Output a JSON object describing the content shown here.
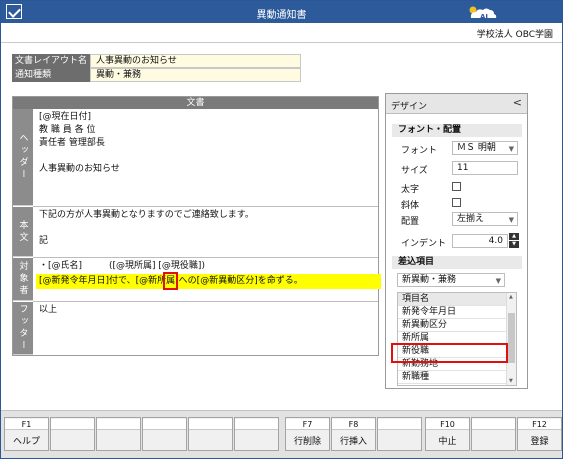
{
  "window": {
    "title": "異動通知書"
  },
  "header": {
    "org_name": "学校法人 OBC学園"
  },
  "form": {
    "layout_label": "文書レイアウト名",
    "layout_value": "人事異動のお知らせ",
    "type_label": "通知種類",
    "type_value": "異動・兼務"
  },
  "document": {
    "title": "文書",
    "sections": [
      {
        "label": "ヘッダー",
        "lines": [
          "[@現在日付]",
          "教 職 員 各 位",
          "責任者 管理部長",
          "",
          "人事異動のお知らせ"
        ]
      },
      {
        "label": "本文",
        "lines": [
          "下記の方が人事異動となりますのでご連絡致します。",
          "",
          "記"
        ]
      },
      {
        "label": "対象者",
        "lines": [
          "・[@氏名]　　　([@現所属] [@現役職])",
          "[@新発令年月日]付で、[@新所属]への[@新異動区分]を命ずる。"
        ]
      },
      {
        "label": "フッター",
        "lines": [
          "以上"
        ]
      }
    ]
  },
  "design": {
    "title": "デザイン",
    "collapse_glyph": "<",
    "font_group": "フォント・配置",
    "font_label": "フォント",
    "font_value": "ＭＳ 明朝",
    "size_label": "サイズ",
    "size_value": "11",
    "bold_label": "太字",
    "italic_label": "斜体",
    "align_label": "配置",
    "align_value": "左揃え",
    "indent_label": "インデント",
    "indent_value": "4.0",
    "insert_group": "差込項目",
    "insert_select": "新異動・兼務",
    "list_header": "項目名",
    "list_items": [
      "新発令年月日",
      "新異動区分",
      "新所属",
      "新役職",
      "新勤務地",
      "新職種"
    ],
    "selected_item": "新役職"
  },
  "fkeys": [
    {
      "key": "F1",
      "label": "ヘルプ"
    },
    {
      "key": "",
      "label": ""
    },
    {
      "key": "",
      "label": ""
    },
    {
      "key": "",
      "label": ""
    },
    {
      "key": "",
      "label": ""
    },
    {
      "key": "",
      "label": ""
    },
    {
      "key": "F7",
      "label": "行削除"
    },
    {
      "key": "F8",
      "label": "行挿入"
    },
    {
      "key": "",
      "label": ""
    },
    {
      "key": "F10",
      "label": "中止"
    },
    {
      "key": "",
      "label": ""
    },
    {
      "key": "F12",
      "label": "登録"
    }
  ],
  "icons": [
    "app-check-icon",
    "cloud-ai-logo-icon",
    "chevron-down-icon",
    "spin-up-icon",
    "spin-down-icon"
  ],
  "colors": {
    "titlebar": "#2d5a9a",
    "highlight": "#ffff00",
    "mark": "#e01010",
    "field_bg": "#fffbe0"
  }
}
